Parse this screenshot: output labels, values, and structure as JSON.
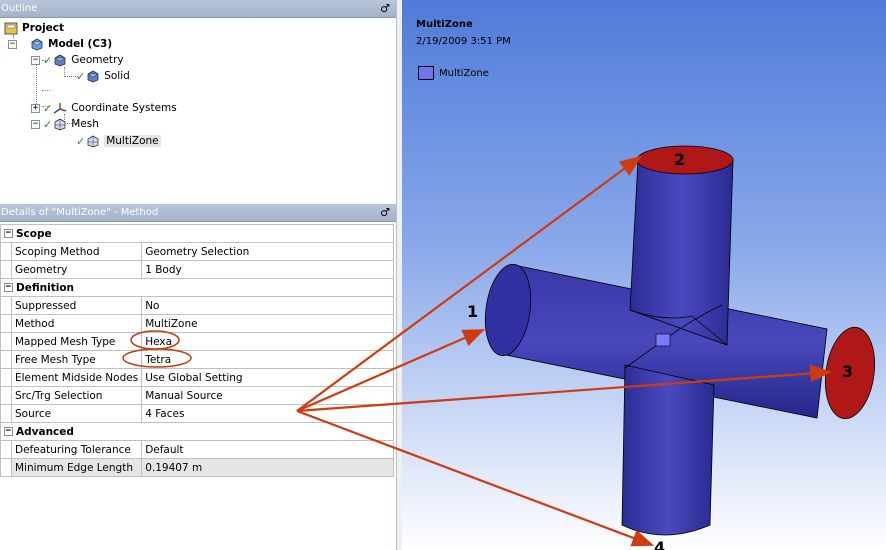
{
  "outline": {
    "title": "Outline",
    "pin": "♂",
    "tree": {
      "project": "Project",
      "model": "Model (C3)",
      "geometry": "Geometry",
      "solid": "Solid",
      "coordinate_systems": "Coordinate Systems",
      "mesh": "Mesh",
      "multizone": "MultiZone"
    }
  },
  "details": {
    "title": "Details of \"MultiZone\" - Method",
    "sections": {
      "scope": "Scope",
      "definition": "Definition",
      "advanced": "Advanced"
    },
    "rows": {
      "scoping_method": {
        "k": "Scoping Method",
        "v": "Geometry Selection"
      },
      "geometry": {
        "k": "Geometry",
        "v": "1 Body"
      },
      "suppressed": {
        "k": "Suppressed",
        "v": "No"
      },
      "method": {
        "k": "Method",
        "v": "MultiZone"
      },
      "mapped_mesh_type": {
        "k": "Mapped Mesh Type",
        "v": "Hexa"
      },
      "free_mesh_type": {
        "k": "Free Mesh Type",
        "v": "Tetra"
      },
      "element_midside_nodes": {
        "k": "Element Midside Nodes",
        "v": "Use Global Setting"
      },
      "src_trg_selection": {
        "k": "Src/Trg Selection",
        "v": "Manual Source"
      },
      "source": {
        "k": "Source",
        "v": "4 Faces"
      },
      "defeaturing_tolerance": {
        "k": "Defeaturing Tolerance",
        "v": "Default"
      },
      "minimum_edge_length": {
        "k": "Minimum Edge Length",
        "v": "0.19407 m"
      }
    }
  },
  "viewport": {
    "title": "MultiZone",
    "timestamp": "2/19/2009 3:51 PM",
    "legend_label": "MultiZone",
    "face_labels": [
      "1",
      "2",
      "3",
      "4"
    ]
  },
  "colors": {
    "body": "#3a3aa8",
    "source_face": "#b01818",
    "arrow": "#d03a10",
    "highlight": "#c83a10"
  }
}
